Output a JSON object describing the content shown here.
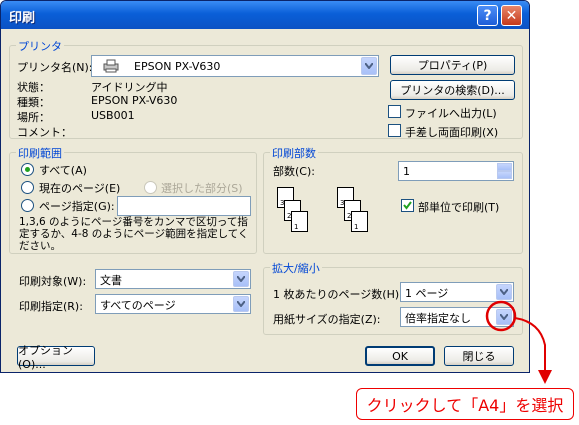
{
  "window": {
    "title": "印刷"
  },
  "printer": {
    "group_title": "プリンタ",
    "name_label": "プリンタ名(N):",
    "name_value": "EPSON PX-V630",
    "status_label": "状態：",
    "status_value": "アイドリング中",
    "type_label": "種類：",
    "type_value": "EPSON PX-V630",
    "where_label": "場所：",
    "where_value": "USB001",
    "comment_label": "コメント："
  },
  "buttons": {
    "properties": "プロパティ(P)",
    "find_printer": "プリンタの検索(D)...",
    "options": "オプション(O)...",
    "ok": "OK",
    "close": "閉じる"
  },
  "checks": {
    "print_to_file": "ファイルへ出力(L)",
    "manual_duplex": "手差し両面印刷(X)",
    "collate": "部単位で印刷(T)"
  },
  "print_range": {
    "group_title": "印刷範囲",
    "all": "すべて(A)",
    "current_page": "現在のページ(E)",
    "selection": "選択した部分(S)",
    "pages": "ページ指定(G):",
    "hint": "1,3,6 のようにページ番号をカンマで区切って指定するか、4-8 のようにページ範囲を指定してください。"
  },
  "copies": {
    "group_title": "印刷部数",
    "count_label": "部数(C):",
    "count_value": "1",
    "page_nums": [
      "1",
      "2",
      "3"
    ]
  },
  "bottom_left": {
    "print_what_label": "印刷対象(W):",
    "print_what_value": "文書",
    "print_label": "印刷指定(R):",
    "print_value": "すべてのページ"
  },
  "zoom": {
    "group_title": "拡大/縮小",
    "pages_per_sheet_label": "1 枚あたりのページ数(H):",
    "pages_per_sheet_value": "1 ページ",
    "scale_label": "用紙サイズの指定(Z):",
    "scale_value": "倍率指定なし"
  },
  "annotation": {
    "callout_text": "クリックして「A4」を選択",
    "highlight_color": "#e00000"
  }
}
